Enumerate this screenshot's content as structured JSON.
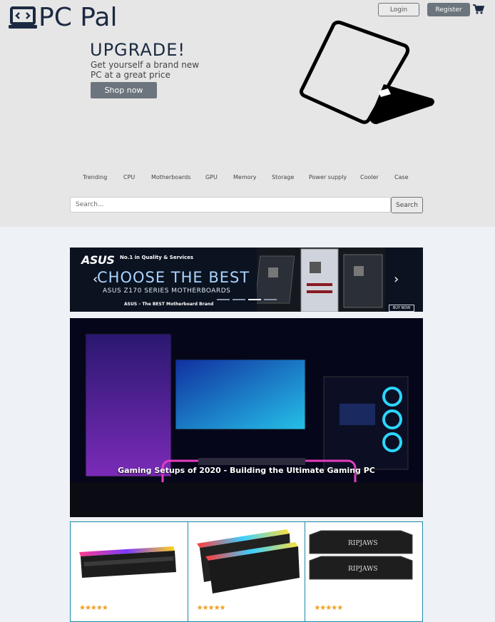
{
  "header": {
    "logo_text": "PC Pal",
    "login_label": "Login",
    "register_label": "Register"
  },
  "hero": {
    "title": "UPGRADE!",
    "subtitle": "Get yourself a brand new PC at a great price",
    "button_label": "Shop now"
  },
  "nav": {
    "items": [
      {
        "label": "Trending"
      },
      {
        "label": "CPU"
      },
      {
        "label": "Motherboards"
      },
      {
        "label": "GPU"
      },
      {
        "label": "Memory"
      },
      {
        "label": "Storage"
      },
      {
        "label": "Power supply"
      },
      {
        "label": "Cooler"
      },
      {
        "label": "Case"
      }
    ]
  },
  "search": {
    "placeholder": "Search...",
    "button_label": "Search"
  },
  "banner": {
    "logo": "ASUS",
    "tagline": "No.1 in Quality & Services",
    "headline": "CHOOSE THE BEST",
    "subheadline": "ASUS Z170 SERIES MOTHERBOARDS",
    "brand_line": "ASUS – The BEST Motherboard Brand",
    "buy_label": "BUY NOW",
    "slide_count": 4,
    "active_slide": 3
  },
  "feature": {
    "caption": "Gaming Setups of 2020 - Building the Ultimate Gaming PC"
  },
  "products": [
    {
      "name": "RGB memory kit",
      "rating": 5,
      "stars": "★★★★★"
    },
    {
      "name": "RGB memory kit (pair)",
      "rating": 5,
      "stars": "★★★★★"
    },
    {
      "name": "Ripjaws V memory",
      "rating": 5,
      "stars": "★★★★★"
    }
  ],
  "colors": {
    "header_bg": "#e6e6e6",
    "page_bg": "#eef2f6",
    "button_gray": "#6c757d",
    "star": "#f0a020",
    "card_border": "#1a8ba8"
  }
}
